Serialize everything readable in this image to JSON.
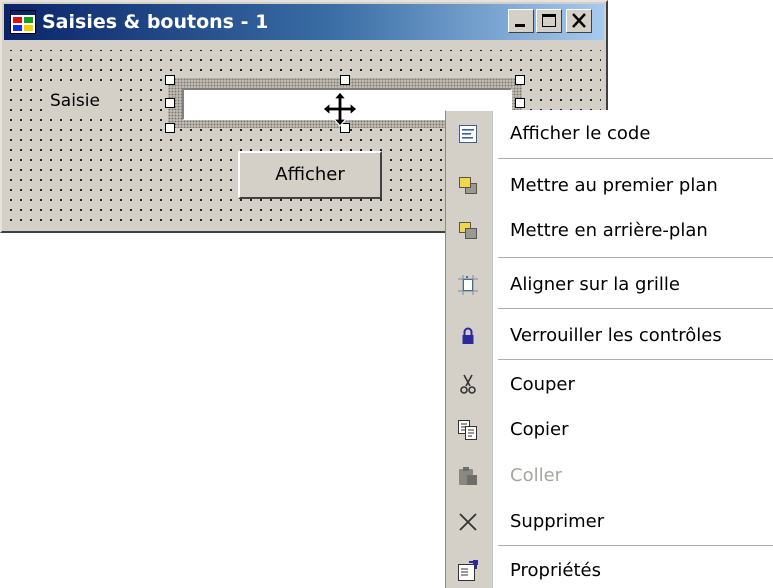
{
  "window": {
    "title": "Saisies & boutons - 1",
    "controls": [
      "minimize",
      "maximize",
      "close"
    ]
  },
  "form": {
    "label_text": "Saisie",
    "textbox_value": "",
    "button_label": "Afficher",
    "cursor": "move-cursor-icon"
  },
  "context_menu": {
    "items": [
      {
        "label": "Afficher le code",
        "icon": "view-code-icon",
        "enabled": true
      },
      {
        "label": "Mettre au premier plan",
        "icon": "bring-to-front-icon",
        "enabled": true
      },
      {
        "label": "Mettre en arrière-plan",
        "icon": "send-to-back-icon",
        "enabled": true
      },
      {
        "label": "Aligner sur la grille",
        "icon": "align-to-grid-icon",
        "enabled": true
      },
      {
        "label": "Verrouiller les contrôles",
        "icon": "lock-icon",
        "enabled": true
      },
      {
        "label": "Couper",
        "icon": "cut-icon",
        "enabled": true
      },
      {
        "label": "Copier",
        "icon": "copy-icon",
        "enabled": true
      },
      {
        "label": "Coller",
        "icon": "paste-icon",
        "enabled": false
      },
      {
        "label": "Supprimer",
        "icon": "delete-icon",
        "enabled": true
      },
      {
        "label": "Propriétés",
        "icon": "properties-icon",
        "enabled": true
      }
    ]
  },
  "colors": {
    "face": "#d4d0c8",
    "title_start": "#0a246a",
    "title_end": "#a6caf0",
    "disabled_text": "#a8a59f"
  }
}
